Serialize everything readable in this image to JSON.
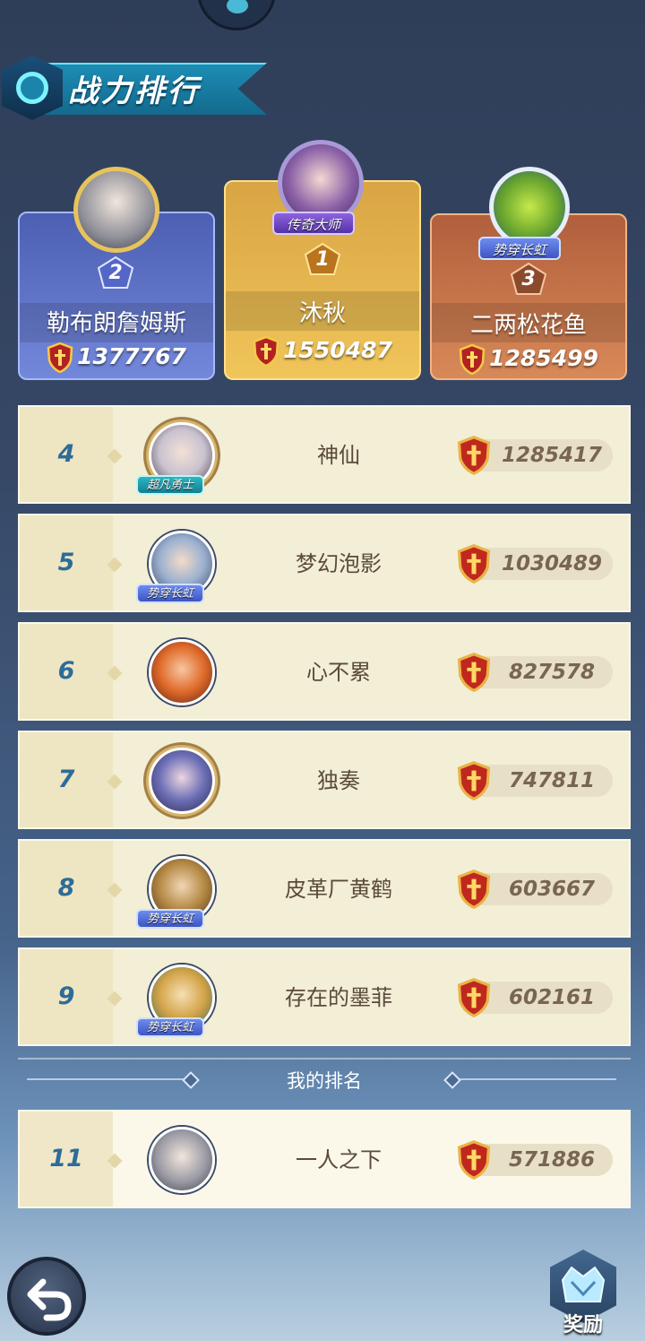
{
  "title": "战力排行",
  "podium": [
    {
      "rank": "2",
      "name": "勒布朗詹姆斯",
      "power": "1377767",
      "tag": ""
    },
    {
      "rank": "1",
      "name": "沐秋",
      "power": "1550487",
      "tag": "传奇大师"
    },
    {
      "rank": "3",
      "name": "二两松花鱼",
      "power": "1285499",
      "tag": "势穿长虹"
    }
  ],
  "rows": [
    {
      "rank": "4",
      "name": "神仙",
      "power": "1285417",
      "tag": "超凡勇士"
    },
    {
      "rank": "5",
      "name": "梦幻泡影",
      "power": "1030489",
      "tag": "势穿长虹"
    },
    {
      "rank": "6",
      "name": "心不累",
      "power": "827578",
      "tag": ""
    },
    {
      "rank": "7",
      "name": "独奏",
      "power": "747811",
      "tag": ""
    },
    {
      "rank": "8",
      "name": "皮革厂黄鹤",
      "power": "603667",
      "tag": "势穿长虹"
    },
    {
      "rank": "9",
      "name": "存在的墨菲",
      "power": "602161",
      "tag": "势穿长虹"
    }
  ],
  "my_rank_label": "我的排名",
  "my_rank": {
    "rank": "11",
    "name": "一人之下",
    "power": "571886"
  },
  "reward_label": "奖励",
  "icons": {
    "back": "back-arrow-icon",
    "reward": "crown-chest-icon",
    "power": "shield-sword-icon"
  },
  "colors": {
    "rank_blue": "#2e6c98",
    "gold": "#f0c55a",
    "silver": "#7388da",
    "bronze": "#d88958"
  }
}
